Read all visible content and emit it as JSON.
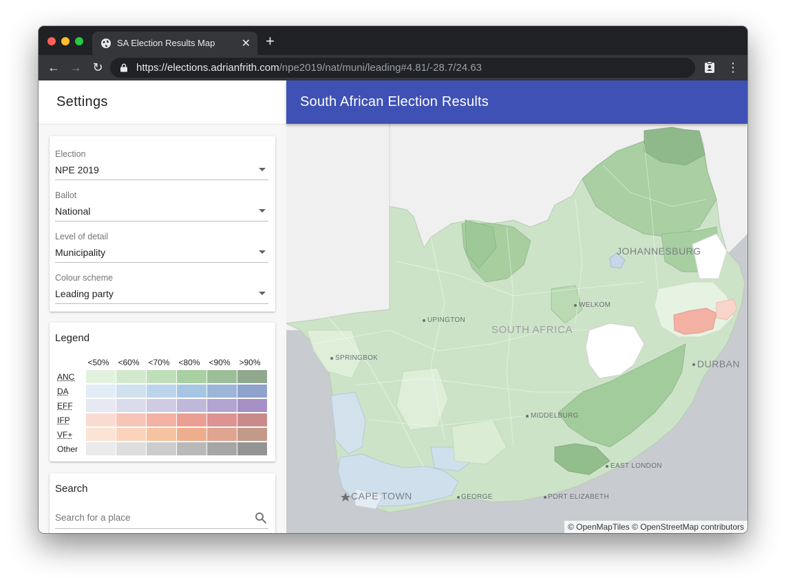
{
  "browser": {
    "tab_title": "SA Election Results Map",
    "url_host": "https://elections.adrianfrith.com",
    "url_path": "/npe2019/nat/muni/leading#4.81/-28.7/24.63"
  },
  "sidebar": {
    "title": "Settings",
    "fields": [
      {
        "label": "Election",
        "value": "NPE 2019"
      },
      {
        "label": "Ballot",
        "value": "National"
      },
      {
        "label": "Level of detail",
        "value": "Municipality"
      },
      {
        "label": "Colour scheme",
        "value": "Leading party"
      }
    ],
    "legend": {
      "title": "Legend",
      "columns": [
        "<50%",
        "<60%",
        "<70%",
        "<80%",
        "<90%",
        ">90%"
      ],
      "rows": [
        {
          "party": "ANC",
          "colors": [
            "#e3f2df",
            "#d2e8cd",
            "#bfdfb8",
            "#a8d0a1",
            "#9cbf99",
            "#8fa88e"
          ]
        },
        {
          "party": "DA",
          "colors": [
            "#e1ecf6",
            "#cfe0ee",
            "#bcd4eb",
            "#a7c6e4",
            "#9db5d8",
            "#90a3cd"
          ]
        },
        {
          "party": "EFF",
          "colors": [
            "#e6e9f1",
            "#dadcec",
            "#cfcbe2",
            "#c0b8da",
            "#b2a5d2",
            "#a591c6"
          ]
        },
        {
          "party": "IFP",
          "colors": [
            "#fadbd2",
            "#f7c5b8",
            "#f2b1a2",
            "#eb9f93",
            "#dc9392",
            "#c88b8a"
          ]
        },
        {
          "party": "VF+",
          "colors": [
            "#fbe4d6",
            "#f9d4bb",
            "#f5c39f",
            "#eeae8d",
            "#dfa591",
            "#c3998a"
          ]
        },
        {
          "party": "Other",
          "colors": [
            "#eaeaea",
            "#dedede",
            "#cccccc",
            "#b9b9b9",
            "#a6a6a6",
            "#949494"
          ]
        }
      ]
    },
    "search": {
      "title": "Search",
      "placeholder": "Search for a place"
    }
  },
  "header": {
    "title": "South African Election Results",
    "color": "#3f51b5"
  },
  "map": {
    "labels": {
      "johannesburg": "JOHANNESBURG",
      "upington": "UPINGTON",
      "welkom": "WELKOM",
      "south_africa": "SOUTH AFRICA",
      "springbok": "SPRINGBOK",
      "durban": "DURBAN",
      "middelburg": "MIDDELBURG",
      "east_london": "EAST LONDON",
      "cape_town": "CAPE TOWN",
      "george": "GEORGE",
      "port_elizabeth": "PORT ELIZABETH"
    },
    "attribution": "© OpenMapTiles © OpenStreetMap contributors"
  }
}
